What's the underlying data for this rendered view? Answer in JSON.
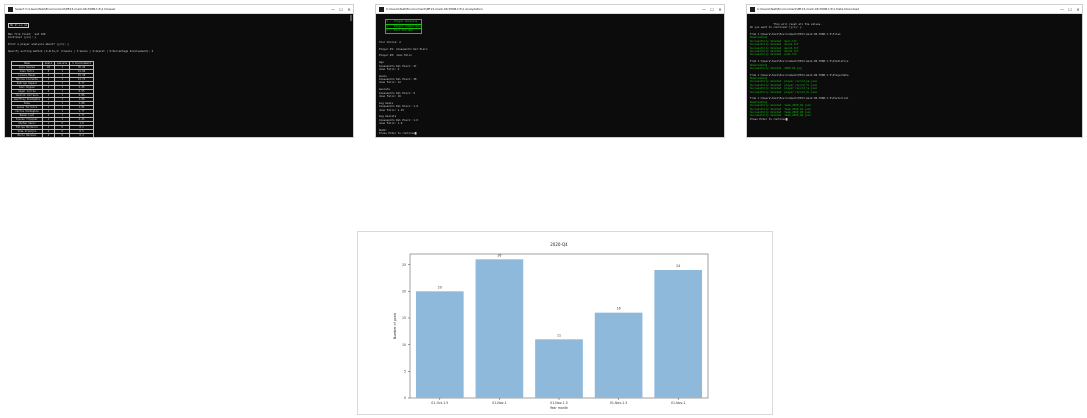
{
  "window1": {
    "title": "Select C:\\Users\\Test\\Environment\\PE13-mai2-06-T06B-t.5\\1 Dossier",
    "controls": [
      "—",
      "☐",
      "✕"
    ],
    "top_lines": [
      {
        "text": "Ok 1\\ Lo ok",
        "green": false,
        "boxed": true
      },
      {
        "text": "",
        "green": false
      },
      {
        "text": "Max file found:  and 166",
        "green": false
      },
      {
        "text": "Continue? (y/n): y",
        "green": false
      },
      {
        "text": "",
        "green": false
      },
      {
        "text": "Print a player analysis about? (y/n): y",
        "green": false
      },
      {
        "text": "",
        "green": false
      },
      {
        "text": "Specify sorting method (1:Alfa,2: 2:Goals | 3:Goals | 4:Assist | 5:Percentage Involvement): 4",
        "green": false
      }
    ],
    "table": {
      "headers": [
        "Name",
        "Goals",
        "Assists",
        "% Involvement"
      ],
      "rows": [
        [
          "Luis Suarez",
          "10",
          "1",
          "35.45"
        ],
        [
          "Joao Felix",
          "5",
          "1",
          "21.66"
        ],
        [
          "Lionel Messi",
          "3",
          "1",
          "15.38"
        ],
        [
          "Marcos Llorente",
          "5",
          "1",
          "12.73"
        ],
        [
          "Rodrigo Depaul",
          "1",
          "1",
          "8.77"
        ],
        [
          "Saul Niguez",
          "1",
          "1",
          "4.45"
        ],
        [
          "Angel Correa",
          "3",
          "1",
          "8.55"
        ],
        [
          "Yannick Carrasco",
          "1",
          "1",
          "2.86"
        ],
        [
          "Geoffrey Kondogbia",
          "1",
          "1",
          "1.88"
        ],
        [
          "Koke",
          "1",
          "1",
          "1.88"
        ],
        [
          "Lucas Torreira",
          "1",
          "1",
          "1.81"
        ],
        [
          "Carlos Kondogbia",
          "1",
          "1",
          "1.77"
        ],
        [
          "Renan Lodi",
          "2",
          "1",
          "1.77"
        ],
        [
          "Kieran Trippier",
          "1",
          "1",
          "4.45"
        ],
        [
          "Stefan Savic",
          "1",
          "0",
          "1.8"
        ],
        [
          "Felipe Monteiro",
          "1",
          "0",
          "0.1"
        ],
        [
          "Sime Vrsaljko",
          "2",
          "0",
          "0.5"
        ],
        [
          "Mario Hermoso",
          "1",
          "0",
          "0.4"
        ],
        [
          "Hector Herrera",
          "3",
          "0",
          "0.3"
        ],
        [
          "Jose Gimenez",
          "1",
          "0",
          "0.4"
        ]
      ]
    },
    "bottom_lines": [
      {
        "text": "Total Goals: 33          Total Assists: 19",
        "green": false
      },
      {
        "text": "",
        "green": false
      },
      {
        "text": "MVP:  Luis Suarez",
        "green": true
      },
      {
        "text": "",
        "green": false
      },
      {
        "text": "Do you want to know about Luis Suarez? (y/n): y",
        "green": false
      },
      {
        "text": "",
        "green": false
      },
      {
        "text": "Luis Alberto Suarez Diaz (Spanish pronunciation: [ luis suarez]; born 24 January 1987) is a Uruguayan professional footballer who plays as a striker for Spanish club Atletico Madrid and the Uruguay national team. He",
        "green": false
      },
      {
        "text": "is regarded as one of the best players in the world, and as one of the greatest strikers of his generation. Suarez has won 18 trophies in his career, which includes six league titles, a UEFA Champions League tit",
        "green": false
      },
      {
        "text": "le, 1 ECW team, and a Copa America with Uruguay.",
        "green": false
      },
      {
        "text": "",
        "green": false
      },
      {
        "text": "Want to know more (y/n): n",
        "green": false
      },
      {
        "text": "",
        "green": false
      },
      {
        "text": "Some predictive data? (y/n): y",
        "green": false
      }
    ]
  },
  "window2": {
    "title": "C:\\Users\\Test\\Environment\\PE13-mai2-06-T06B-t.5\\1 Analyzation",
    "controls": [
      "—",
      "☐",
      "✕"
    ],
    "menu": [
      "1 -  Player analysis  ",
      "2 -  Player comparison",
      "3 -  Exit the app     "
    ],
    "lines": [
      {
        "text": "",
        "green": false
      },
      {
        "text": "Your Choice: 2",
        "green": false
      },
      {
        "text": "",
        "green": false
      },
      {
        "text": "Player #1: Alessandro Del Piero",
        "green": false
      },
      {
        "text": "",
        "green": false
      },
      {
        "text": "Player #2: Joao Felix",
        "green": false
      },
      {
        "text": "",
        "green": false
      },
      {
        "text": "Age",
        "green": false
      },
      {
        "text": "Alessandro Del Piero: 47",
        "green": false
      },
      {
        "text": "Joao Felix: 4",
        "green": false
      },
      {
        "text": "",
        "green": false
      },
      {
        "text": "Goals",
        "green": false
      },
      {
        "text": "Alessandro Del Piero: 38",
        "green": false
      },
      {
        "text": "Joao Felix: 12",
        "green": false
      },
      {
        "text": "",
        "green": false
      },
      {
        "text": "Assists",
        "green": false
      },
      {
        "text": "Alessandro Del Piero: 9",
        "green": false
      },
      {
        "text": "Joao Felix: 16",
        "green": false
      },
      {
        "text": "",
        "green": false
      },
      {
        "text": "Avg Goals",
        "green": false
      },
      {
        "text": "Alessandro Del Piero: 1.6",
        "green": false
      },
      {
        "text": "Joao Felix: 1.15",
        "green": false
      },
      {
        "text": "",
        "green": false
      },
      {
        "text": "Avg Assists",
        "green": false
      },
      {
        "text": "Alessandro Del Piero: 1.6",
        "green": false
      },
      {
        "text": "Joao Felix: 1.6",
        "green": false
      },
      {
        "text": "",
        "green": false
      },
      {
        "text": "Dumb!",
        "green": false
      },
      {
        "text": "Press Enter to continue█",
        "green": false
      }
    ]
  },
  "window3": {
    "title": "C:\\Users\\Test\\Environment\\PE13-mai2-06-T06B-t.5\\1 Data Download",
    "controls": [
      "—",
      "☐",
      "✕"
    ],
    "lines": [
      {
        "text": "               This will reset all the values.",
        "green": false
      },
      {
        "text": "Do you want to continue? (y/n): y",
        "green": false
      },
      {
        "text": "",
        "green": false
      },
      {
        "text": "From C:\\Users\\Test\\Environment\\PE13-mai2-06-T06B-t.5\\Files",
        "green": false
      },
      {
        "text": "Downloading",
        "green": true
      },
      {
        "text": "Successfully deleted  main.txt",
        "green": true
      },
      {
        "text": "Successfully deleted  main2.txt",
        "green": true
      },
      {
        "text": "Successfully deleted  main3.txt",
        "green": true
      },
      {
        "text": "Successfully deleted  mainb.txt",
        "green": true
      },
      {
        "text": "Successfully deleted  post.txt",
        "green": true
      },
      {
        "text": "",
        "green": false
      },
      {
        "text": "From C:\\Users\\Test\\Environment\\PE13-mai2-06-T06B-t.5\\Statistics",
        "green": false
      },
      {
        "text": "Downloading",
        "green": true
      },
      {
        "text": "Successfully deleted  2020-Q4.jpg",
        "green": true
      },
      {
        "text": "",
        "green": false
      },
      {
        "text": "From C:\\Users\\Test\\Environment\\PE13-mai2-06-T06B-t.5\\Playerdata",
        "green": false
      },
      {
        "text": "Downloading",
        "green": true
      },
      {
        "text": "Successfully deleted  player_record_pp.json",
        "green": true
      },
      {
        "text": "Successfully deleted  player_record_fc.json",
        "green": true
      },
      {
        "text": "Successfully deleted  player_record_ls.json",
        "green": true
      },
      {
        "text": "Successfully deleted  player_record_mc.json",
        "green": true
      },
      {
        "text": "",
        "green": false
      },
      {
        "text": "From C:\\Users\\Test\\Environment\\PE13-mai2-06-T06B-t.5\\Historical",
        "green": false
      },
      {
        "text": "Downloading",
        "green": true
      },
      {
        "text": "Successfully deleted  team_2020_Q1.json",
        "green": true
      },
      {
        "text": "Successfully deleted  team_2020_Q2.json",
        "green": true
      },
      {
        "text": "Successfully deleted  team_2020_Q3.json",
        "green": true
      },
      {
        "text": "Successfully deleted  team_2020_Q4.json",
        "green": true
      },
      {
        "text": "Press Enter to continue█",
        "green": false
      }
    ]
  },
  "chart_data": {
    "type": "bar",
    "title": "2020-Q4",
    "xlabel": "Year month",
    "ylabel": "Number of goals",
    "categories": [
      "01-Oct-1.5",
      "01-Nov-1",
      "01-Nov-1.5",
      "01-Nov-1.5",
      "01-Nov-1"
    ],
    "values": [
      20,
      26,
      11,
      16,
      24
    ],
    "ylim": [
      0,
      27
    ],
    "yticks": [
      0,
      5,
      10,
      15,
      20,
      25
    ],
    "bar_color": "#8fb9db",
    "grid": false
  }
}
